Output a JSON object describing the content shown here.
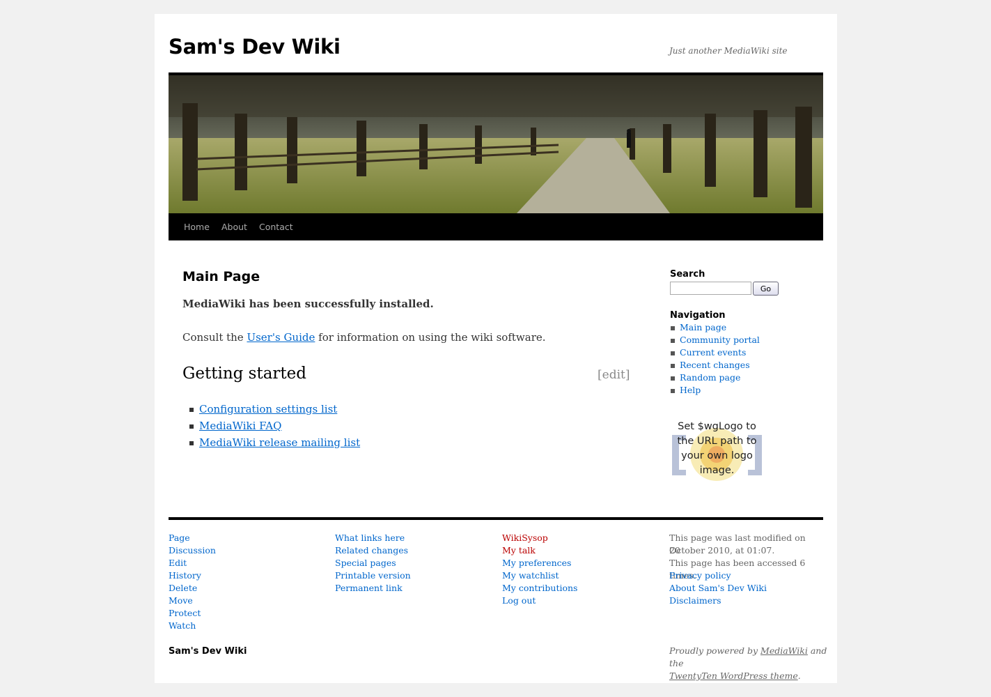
{
  "site": {
    "title": "Sam's Dev Wiki",
    "description": "Just another MediaWiki site"
  },
  "menu": [
    "Home",
    "About",
    "Contact"
  ],
  "content": {
    "page_title": "Main Page",
    "installed": "MediaWiki has been successfully installed.",
    "consult_prefix": "Consult the ",
    "consult_link": "User's Guide",
    "consult_suffix": " for information on using the wiki software.",
    "heading": "Getting started",
    "edit_open": "[",
    "edit_label": "edit",
    "edit_close": "]",
    "links": [
      "Configuration settings list",
      "MediaWiki FAQ",
      "MediaWiki release mailing list"
    ]
  },
  "sidebar": {
    "search_label": "Search",
    "search_value": "",
    "go_label": "Go",
    "nav_label": "Navigation",
    "nav_items": [
      "Main page",
      "Community portal",
      "Current events",
      "Recent changes",
      "Random page",
      "Help"
    ],
    "logo_text": "Set $wgLogo to the URL path to your own logo image."
  },
  "footer": {
    "col1": [
      "Page",
      "Discussion",
      "Edit",
      "History",
      "Delete",
      "Move",
      "Protect",
      "Watch"
    ],
    "col2": [
      "What links here",
      "Related changes",
      "Special pages",
      "Printable version",
      "Permanent link"
    ],
    "col3": [
      "WikiSysop",
      "My talk",
      "My preferences",
      "My watchlist",
      "My contributions",
      "Log out"
    ],
    "col4_info": [
      "This page was last modified on 20",
      "October 2010, at 01:07.",
      "This page has been accessed 6 times."
    ],
    "col4_links": [
      "Privacy policy",
      "About Sam's Dev Wiki",
      "Disclaimers"
    ],
    "site_name": "Sam's Dev Wiki",
    "powered_prefix": "Proudly powered by ",
    "powered_link1": "MediaWiki",
    "powered_mid": " and the",
    "powered_link2": "TwentyTen WordPress theme",
    "powered_suffix": "."
  },
  "colors": {
    "link": "#0066cc",
    "new_link": "#ba0000",
    "page_bg": "#f1f1f1",
    "menu_bg": "#000000"
  }
}
